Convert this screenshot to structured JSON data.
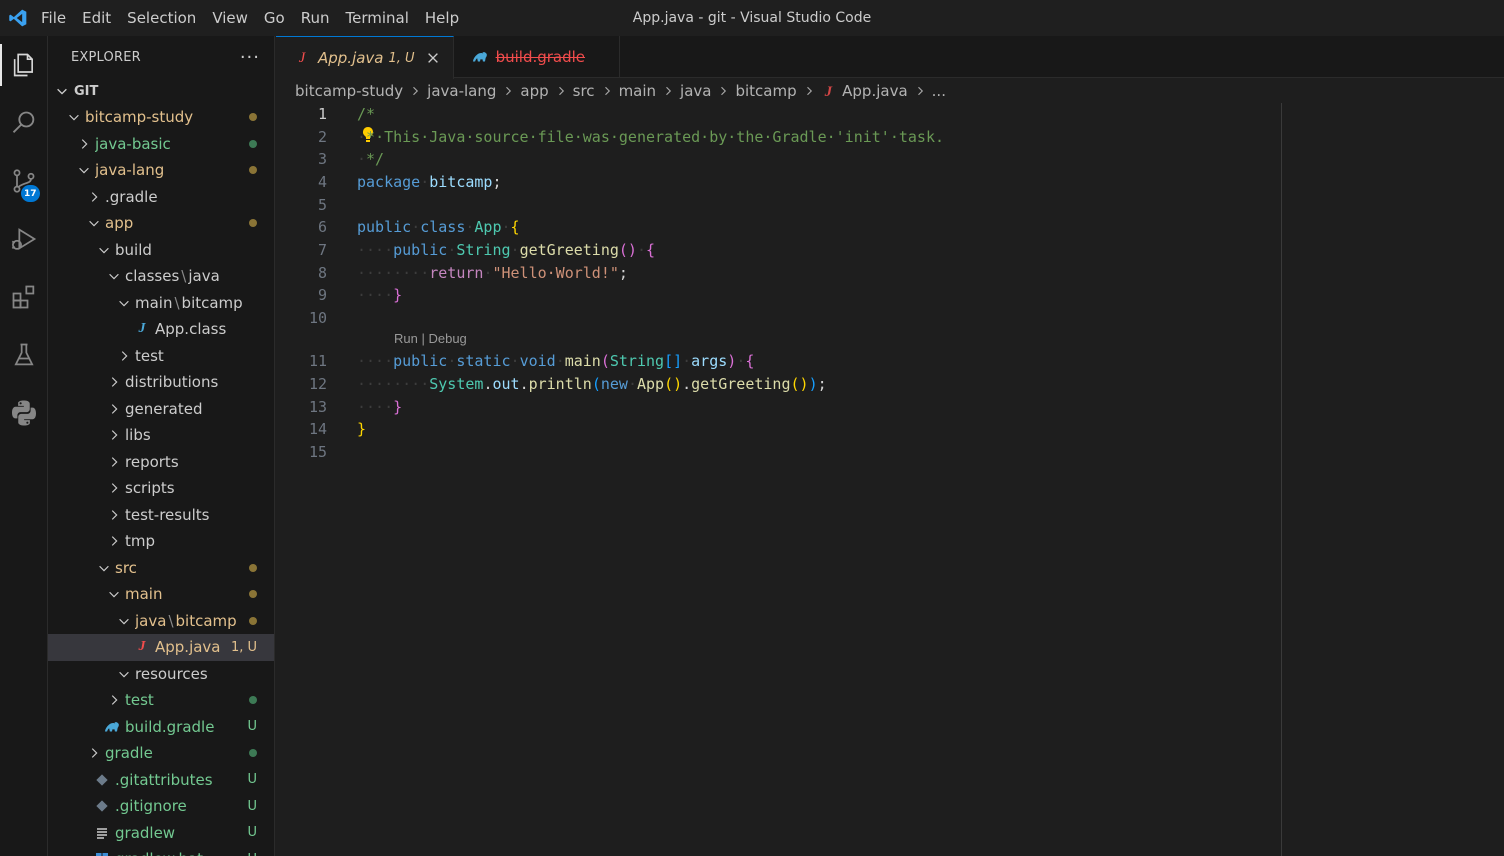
{
  "window": {
    "title": "App.java - git - Visual Studio Code"
  },
  "menu": [
    "File",
    "Edit",
    "Selection",
    "View",
    "Go",
    "Run",
    "Terminal",
    "Help"
  ],
  "activity": {
    "scm_badge": "17"
  },
  "sidebar": {
    "title": "EXPLORER",
    "more": "···",
    "section": "GIT",
    "tree": [
      {
        "label": "bitcamp-study",
        "depth": 1,
        "chevron": "down",
        "status": "modified",
        "deco": "dot"
      },
      {
        "label": "java-basic",
        "depth": 2,
        "chevron": "right",
        "status": "new",
        "deco": "dot"
      },
      {
        "label": "java-lang",
        "depth": 2,
        "chevron": "down",
        "status": "modified",
        "deco": "dot"
      },
      {
        "label": ".gradle",
        "depth": 3,
        "chevron": "right",
        "status": "default"
      },
      {
        "label": "app",
        "depth": 3,
        "chevron": "down",
        "status": "modified",
        "deco": "dot"
      },
      {
        "label": "build",
        "depth": 4,
        "chevron": "down",
        "status": "default"
      },
      {
        "label": "classes",
        "label2": "java",
        "depth": 5,
        "chevron": "down",
        "status": "default"
      },
      {
        "label": "main",
        "label2": "bitcamp",
        "depth": 6,
        "chevron": "down",
        "status": "default"
      },
      {
        "label": "App.class",
        "depth": 7,
        "icon": "java-class",
        "status": "default"
      },
      {
        "label": "test",
        "depth": 6,
        "chevron": "right",
        "status": "default"
      },
      {
        "label": "distributions",
        "depth": 5,
        "chevron": "right",
        "status": "default"
      },
      {
        "label": "generated",
        "depth": 5,
        "chevron": "right",
        "status": "default"
      },
      {
        "label": "libs",
        "depth": 5,
        "chevron": "right",
        "status": "default"
      },
      {
        "label": "reports",
        "depth": 5,
        "chevron": "right",
        "status": "default"
      },
      {
        "label": "scripts",
        "depth": 5,
        "chevron": "right",
        "status": "default"
      },
      {
        "label": "test-results",
        "depth": 5,
        "chevron": "right",
        "status": "default"
      },
      {
        "label": "tmp",
        "depth": 5,
        "chevron": "right",
        "status": "default"
      },
      {
        "label": "src",
        "depth": 4,
        "chevron": "down",
        "status": "modified",
        "deco": "dot"
      },
      {
        "label": "main",
        "depth": 5,
        "chevron": "down",
        "status": "modified",
        "deco": "dot"
      },
      {
        "label": "java",
        "label2": "bitcamp",
        "depth": 6,
        "chevron": "down",
        "status": "modified",
        "deco": "dot"
      },
      {
        "label": "App.java",
        "depth": 7,
        "icon": "java",
        "status": "modified",
        "deco": "1, U",
        "selected": true
      },
      {
        "label": "resources",
        "depth": 6,
        "chevron": "down",
        "status": "default"
      },
      {
        "label": "test",
        "depth": 5,
        "chevron": "right",
        "status": "new",
        "deco": "dot"
      },
      {
        "label": "build.gradle",
        "depth": 4,
        "icon": "gradle",
        "status": "new",
        "deco": "U"
      },
      {
        "label": "gradle",
        "depth": 3,
        "chevron": "right",
        "status": "new",
        "deco": "dot"
      },
      {
        "label": ".gitattributes",
        "depth": 3,
        "icon": "git",
        "status": "new",
        "deco": "U"
      },
      {
        "label": ".gitignore",
        "depth": 3,
        "icon": "git",
        "status": "new",
        "deco": "U"
      },
      {
        "label": "gradlew",
        "depth": 3,
        "icon": "lines",
        "status": "new",
        "deco": "U"
      },
      {
        "label": "gradlew.bat",
        "depth": 3,
        "icon": "windows",
        "status": "new",
        "deco": "U"
      }
    ]
  },
  "tabs": [
    {
      "label": "App.java",
      "status": "1, U",
      "active": true,
      "icon": "java"
    },
    {
      "label": "build.gradle",
      "active": false,
      "deleted": true,
      "icon": "gradle"
    }
  ],
  "breadcrumb": [
    "bitcamp-study",
    "java-lang",
    "app",
    "src",
    "main",
    "java",
    "bitcamp",
    "App.java",
    "..."
  ],
  "editor": {
    "codelens": {
      "run": "Run",
      "sep": " | ",
      "debug": "Debug"
    },
    "lines": [
      {
        "n": "1",
        "tokens": [
          [
            "/*",
            "t-com"
          ]
        ]
      },
      {
        "n": "2",
        "tokens": [
          [
            "·",
            "ws"
          ],
          [
            "*",
            "t-com"
          ],
          [
            "·This·Java·source·file·was·generated·by·the·Gradle·'init'·task.",
            "t-com"
          ]
        ]
      },
      {
        "n": "3",
        "tokens": [
          [
            "·",
            "ws"
          ],
          [
            "*/",
            "t-com"
          ]
        ]
      },
      {
        "n": "4",
        "tokens": [
          [
            "package",
            "t-kw"
          ],
          [
            "·",
            "ws"
          ],
          [
            "bitcamp",
            "t-var"
          ],
          [
            ";",
            "t-plain"
          ]
        ]
      },
      {
        "n": "5",
        "tokens": []
      },
      {
        "n": "6",
        "tokens": [
          [
            "public",
            "t-kw"
          ],
          [
            "·",
            "ws"
          ],
          [
            "class",
            "t-kw"
          ],
          [
            "·",
            "ws"
          ],
          [
            "App",
            "t-type"
          ],
          [
            "·",
            "ws"
          ],
          [
            "{",
            "b1"
          ]
        ]
      },
      {
        "n": "7",
        "tokens": [
          [
            "····",
            "ws"
          ],
          [
            "public",
            "t-kw"
          ],
          [
            "·",
            "ws"
          ],
          [
            "String",
            "t-type"
          ],
          [
            "·",
            "ws"
          ],
          [
            "getGreeting",
            "t-fn"
          ],
          [
            "()",
            "b2"
          ],
          [
            "·",
            "ws"
          ],
          [
            "{",
            "b2"
          ]
        ]
      },
      {
        "n": "8",
        "tokens": [
          [
            "········",
            "ws"
          ],
          [
            "return",
            "t-ctl"
          ],
          [
            "·",
            "ws"
          ],
          [
            "\"Hello·World!\"",
            "t-str"
          ],
          [
            ";",
            "t-plain"
          ]
        ]
      },
      {
        "n": "9",
        "tokens": [
          [
            "····",
            "ws"
          ],
          [
            "}",
            "b2"
          ]
        ]
      },
      {
        "n": "10",
        "tokens": []
      },
      {
        "n": "11",
        "tokens": [
          [
            "····",
            "ws"
          ],
          [
            "public",
            "t-kw"
          ],
          [
            "·",
            "ws"
          ],
          [
            "static",
            "t-kw"
          ],
          [
            "·",
            "ws"
          ],
          [
            "void",
            "t-kw"
          ],
          [
            "·",
            "ws"
          ],
          [
            "main",
            "t-fn"
          ],
          [
            "(",
            "b2"
          ],
          [
            "String",
            "t-type"
          ],
          [
            "[]",
            "b3"
          ],
          [
            "·",
            "ws"
          ],
          [
            "args",
            "t-var"
          ],
          [
            ")",
            "b2"
          ],
          [
            "·",
            "ws"
          ],
          [
            "{",
            "b2"
          ]
        ]
      },
      {
        "n": "12",
        "tokens": [
          [
            "········",
            "ws"
          ],
          [
            "System",
            "t-type"
          ],
          [
            ".",
            "t-plain"
          ],
          [
            "out",
            "t-var"
          ],
          [
            ".",
            "t-plain"
          ],
          [
            "println",
            "t-fn"
          ],
          [
            "(",
            "b3"
          ],
          [
            "new",
            "t-kw"
          ],
          [
            "·",
            "ws"
          ],
          [
            "App",
            "t-fn"
          ],
          [
            "()",
            "b1"
          ],
          [
            ".",
            "t-plain"
          ],
          [
            "getGreeting",
            "t-fn"
          ],
          [
            "()",
            "b1"
          ],
          [
            ")",
            "b3"
          ],
          [
            ";",
            "t-plain"
          ]
        ]
      },
      {
        "n": "13",
        "tokens": [
          [
            "····",
            "ws"
          ],
          [
            "}",
            "b2"
          ]
        ]
      },
      {
        "n": "14",
        "tokens": [
          [
            "}",
            "b1"
          ]
        ]
      },
      {
        "n": "15",
        "tokens": []
      }
    ]
  },
  "colors": {
    "accent": "#0078d4",
    "modified": "#e2c08d",
    "untracked": "#73c991",
    "deleted": "#f14c4c",
    "java_icon": "#f14c4c",
    "gradle_icon": "#4aa8d8"
  }
}
